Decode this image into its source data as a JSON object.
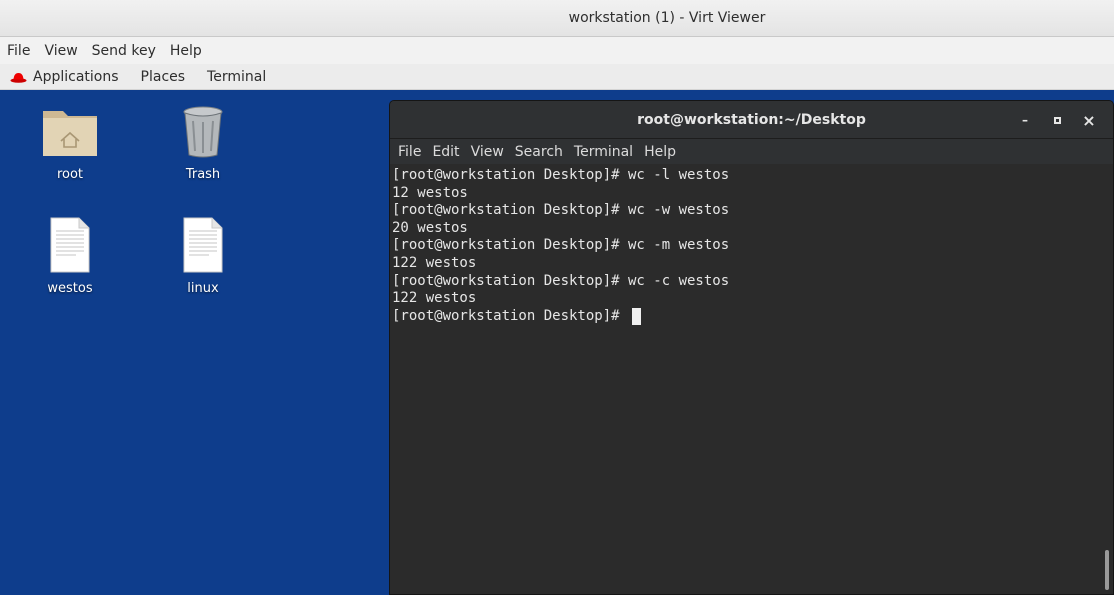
{
  "window": {
    "title": "workstation (1) - Virt Viewer"
  },
  "viewer_menu": [
    "File",
    "View",
    "Send key",
    "Help"
  ],
  "gnome_bar": {
    "items": [
      "Applications",
      "Places",
      "Terminal"
    ]
  },
  "desktop": {
    "icons": [
      {
        "label": "root",
        "icon": "home-folder-icon"
      },
      {
        "label": "Trash",
        "icon": "trash-icon"
      },
      {
        "label": "westos",
        "icon": "text-file-icon"
      },
      {
        "label": "linux",
        "icon": "text-file-icon"
      }
    ]
  },
  "terminal": {
    "title": "root@workstation:~/Desktop",
    "menu": [
      "File",
      "Edit",
      "View",
      "Search",
      "Terminal",
      "Help"
    ],
    "lines": [
      "[root@workstation Desktop]# wc -l westos",
      "12 westos",
      "[root@workstation Desktop]# wc -w westos",
      "20 westos",
      "[root@workstation Desktop]# wc -m westos",
      "122 westos",
      "[root@workstation Desktop]# wc -c westos",
      "122 westos",
      "[root@workstation Desktop]# "
    ],
    "controls": {
      "minimize": "–",
      "maximize": "□",
      "close": "×"
    }
  },
  "colors": {
    "desktop_bg": "#0e3d8c",
    "terminal_bg": "#2b2b2b",
    "terminal_fg": "#e6e6e6"
  }
}
